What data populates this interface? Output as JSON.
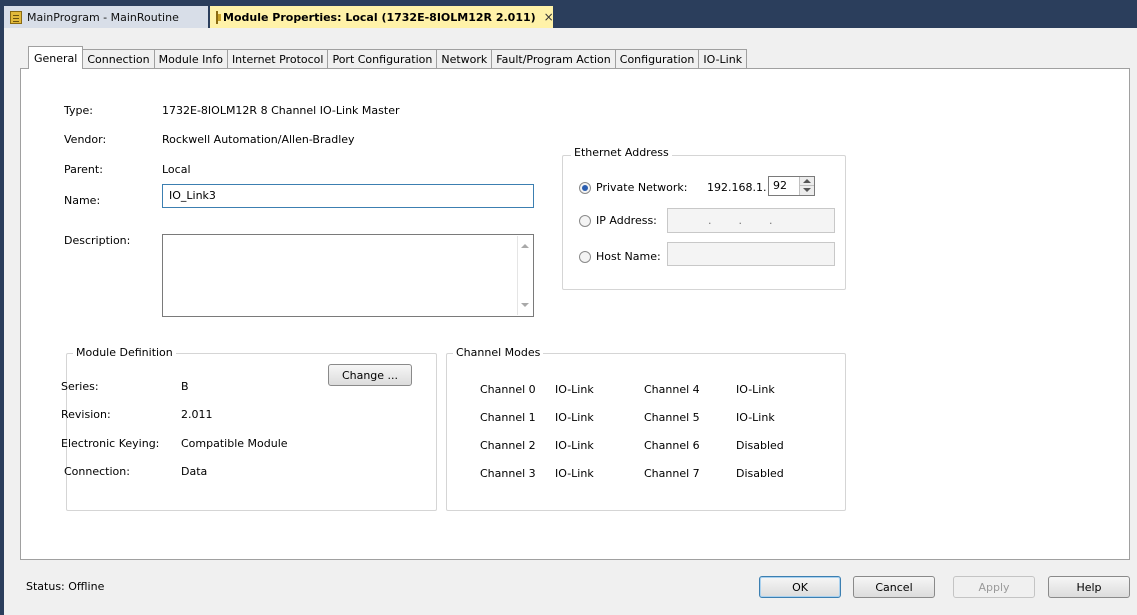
{
  "doc_tabs": {
    "inactive": "MainProgram - MainRoutine",
    "active": "Module Properties: Local (1732E-8IOLM12R 2.011)",
    "close": "×"
  },
  "tabs": [
    "General",
    "Connection",
    "Module Info",
    "Internet Protocol",
    "Port Configuration",
    "Network",
    "Fault/Program Action",
    "Configuration",
    "IO-Link"
  ],
  "general": {
    "type_label": "Type:",
    "type_value": "1732E-8IOLM12R 8 Channel IO-Link Master",
    "vendor_label": "Vendor:",
    "vendor_value": "Rockwell Automation/Allen-Bradley",
    "parent_label": "Parent:",
    "parent_value": "Local",
    "name_label": "Name:",
    "name_value": "IO_Link3",
    "description_label": "Description:",
    "description_value": ""
  },
  "ethernet": {
    "title": "Ethernet Address",
    "private_label": "Private Network:",
    "private_prefix": "192.168.1.",
    "private_value": "92",
    "ip_label": "IP Address:",
    "ip_dots": [
      ".",
      ".",
      "."
    ],
    "host_label": "Host Name:"
  },
  "module_definition": {
    "title": "Module Definition",
    "series_label": "Series:",
    "series_value": "B",
    "revision_label": "Revision:",
    "revision_value": "2.011",
    "keying_label": "Electronic Keying:",
    "keying_value": "Compatible Module",
    "connection_label": "Connection:",
    "connection_value": "Data",
    "change_button": "Change ..."
  },
  "channel_modes": {
    "title": "Channel Modes",
    "channels": [
      {
        "name": "Channel 0",
        "mode": "IO-Link"
      },
      {
        "name": "Channel 1",
        "mode": "IO-Link"
      },
      {
        "name": "Channel 2",
        "mode": "IO-Link"
      },
      {
        "name": "Channel 3",
        "mode": "IO-Link"
      },
      {
        "name": "Channel 4",
        "mode": "IO-Link"
      },
      {
        "name": "Channel 5",
        "mode": "IO-Link"
      },
      {
        "name": "Channel 6",
        "mode": "Disabled"
      },
      {
        "name": "Channel 7",
        "mode": "Disabled"
      }
    ]
  },
  "footer": {
    "status": "Status:  Offline",
    "ok": "OK",
    "cancel": "Cancel",
    "apply": "Apply",
    "help": "Help"
  }
}
